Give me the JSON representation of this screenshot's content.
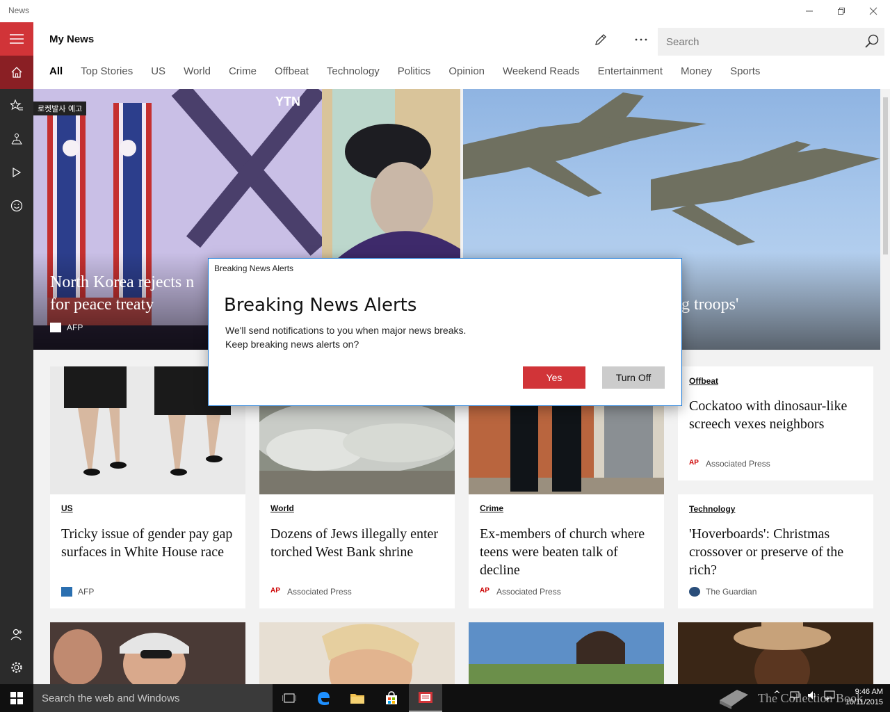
{
  "app": {
    "name": "News"
  },
  "header": {
    "title": "My News",
    "search_placeholder": "Search",
    "tabs": [
      {
        "label": "All",
        "active": true
      },
      {
        "label": "Top Stories"
      },
      {
        "label": "US"
      },
      {
        "label": "World"
      },
      {
        "label": "Crime"
      },
      {
        "label": "Offbeat"
      },
      {
        "label": "Technology"
      },
      {
        "label": "Politics"
      },
      {
        "label": "Opinion"
      },
      {
        "label": "Weekend Reads"
      },
      {
        "label": "Entertainment"
      },
      {
        "label": "Money"
      },
      {
        "label": "Sports"
      }
    ]
  },
  "sidebar": {
    "icons": [
      "hamburger-menu-icon",
      "home-icon",
      "favorites-icon",
      "local-icon",
      "video-icon",
      "feedback-icon",
      "account-icon",
      "settings-icon"
    ]
  },
  "hero": {
    "left": {
      "title_line1": "North Korea rejects n",
      "title_line2": "for peace treaty",
      "source": "AFP",
      "broadcaster": "YTN",
      "banner": "로켓발사 예고"
    },
    "right": {
      "title_fragment": "g troops'"
    }
  },
  "cards": {
    "offbeat": {
      "category": "Offbeat",
      "headline": "Cockatoo with dinosaur-like screech vexes neighbors",
      "source": "Associated Press"
    },
    "row2": [
      {
        "category": "US",
        "headline": "Tricky issue of gender pay gap surfaces in White House race",
        "source": "AFP"
      },
      {
        "category": "World",
        "headline": "Dozens of Jews illegally enter torched West Bank shrine",
        "source": "Associated Press"
      },
      {
        "category": "Crime",
        "headline": "Ex-members of church where teens were beaten talk of decline",
        "source": "Associated Press"
      },
      {
        "category": "Technology",
        "headline": "'Hoverboards': Christmas crossover or preserve of the rich?",
        "source": "The Guardian"
      }
    ]
  },
  "dialog": {
    "caption": "Breaking News Alerts",
    "title": "Breaking News Alerts",
    "line1": "We'll send notifications to you when major news breaks.",
    "line2": "Keep breaking news alerts on?",
    "yes_label": "Yes",
    "off_label": "Turn Off"
  },
  "taskbar": {
    "search_placeholder": "Search the web and Windows",
    "time": "9:46 AM",
    "date": "10/11/2015",
    "watermark": "The Collection Book"
  },
  "colors": {
    "accent": "#d13438",
    "sidebar": "#2b2b2b",
    "taskbar": "#101010"
  }
}
